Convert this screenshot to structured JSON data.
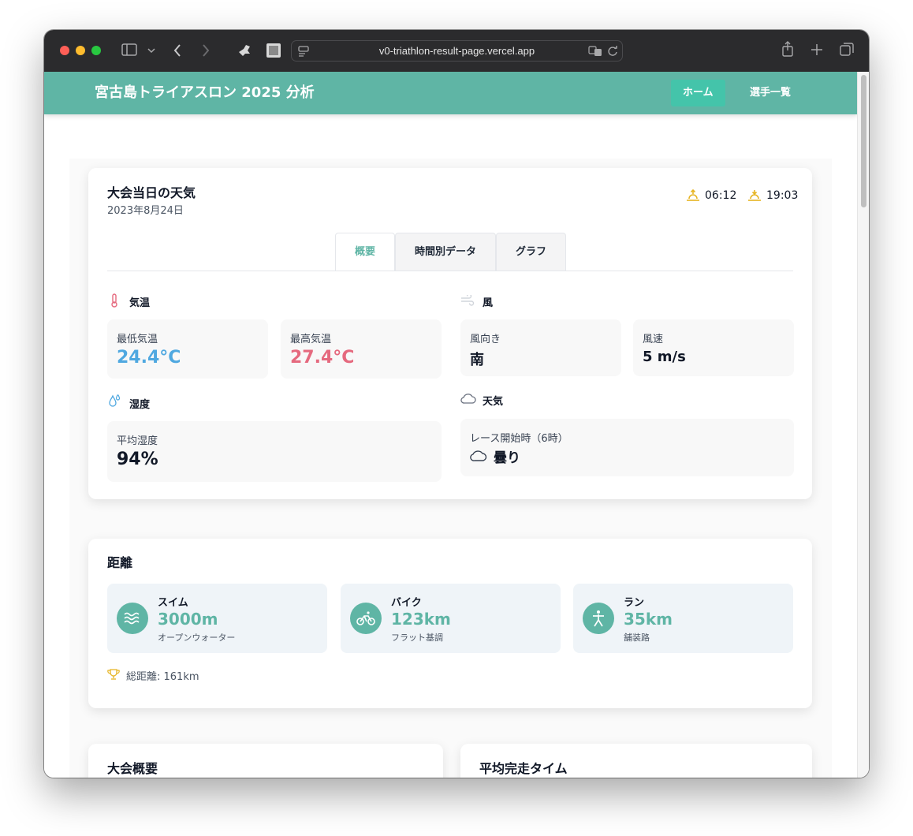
{
  "browser": {
    "url": "v0-triathlon-result-page.vercel.app"
  },
  "header": {
    "title": "宮古島トライアスロン 2025 分析",
    "nav": [
      {
        "label": "ホーム"
      },
      {
        "label": "選手一覧"
      }
    ]
  },
  "weather": {
    "title": "大会当日の天気",
    "date": "2023年8月24日",
    "sunrise": "06:12",
    "sunset": "19:03",
    "tabs": [
      {
        "label": "概要"
      },
      {
        "label": "時間別データ"
      },
      {
        "label": "グラフ"
      }
    ],
    "temperature": {
      "title": "気温",
      "min_label": "最低気温",
      "min_value": "24.4°C",
      "max_label": "最高気温",
      "max_value": "27.4°C"
    },
    "wind": {
      "title": "風",
      "direction_label": "風向き",
      "direction_value": "南",
      "speed_label": "風速",
      "speed_value": "5 m/s"
    },
    "humidity": {
      "title": "湿度",
      "avg_label": "平均湿度",
      "avg_value": "94%"
    },
    "condition": {
      "title": "天気",
      "start_label": "レース開始時（6時）",
      "start_value": "曇り"
    },
    "colors": {
      "min": "#4fa8e0",
      "max": "#e5697e",
      "accent": "#5fb5a5"
    }
  },
  "distance": {
    "title": "距離",
    "items": [
      {
        "name": "スイム",
        "amount": "3000m",
        "desc": "オープンウォーター",
        "icon": "waves-icon"
      },
      {
        "name": "バイク",
        "amount": "123km",
        "desc": "フラット基調",
        "icon": "bike-icon"
      },
      {
        "name": "ラン",
        "amount": "35km",
        "desc": "舗装路",
        "icon": "runner-icon"
      }
    ],
    "total": "総距離: 161km"
  },
  "overview": {
    "title": "大会概要"
  },
  "avg_time": {
    "title": "平均完走タイム"
  }
}
